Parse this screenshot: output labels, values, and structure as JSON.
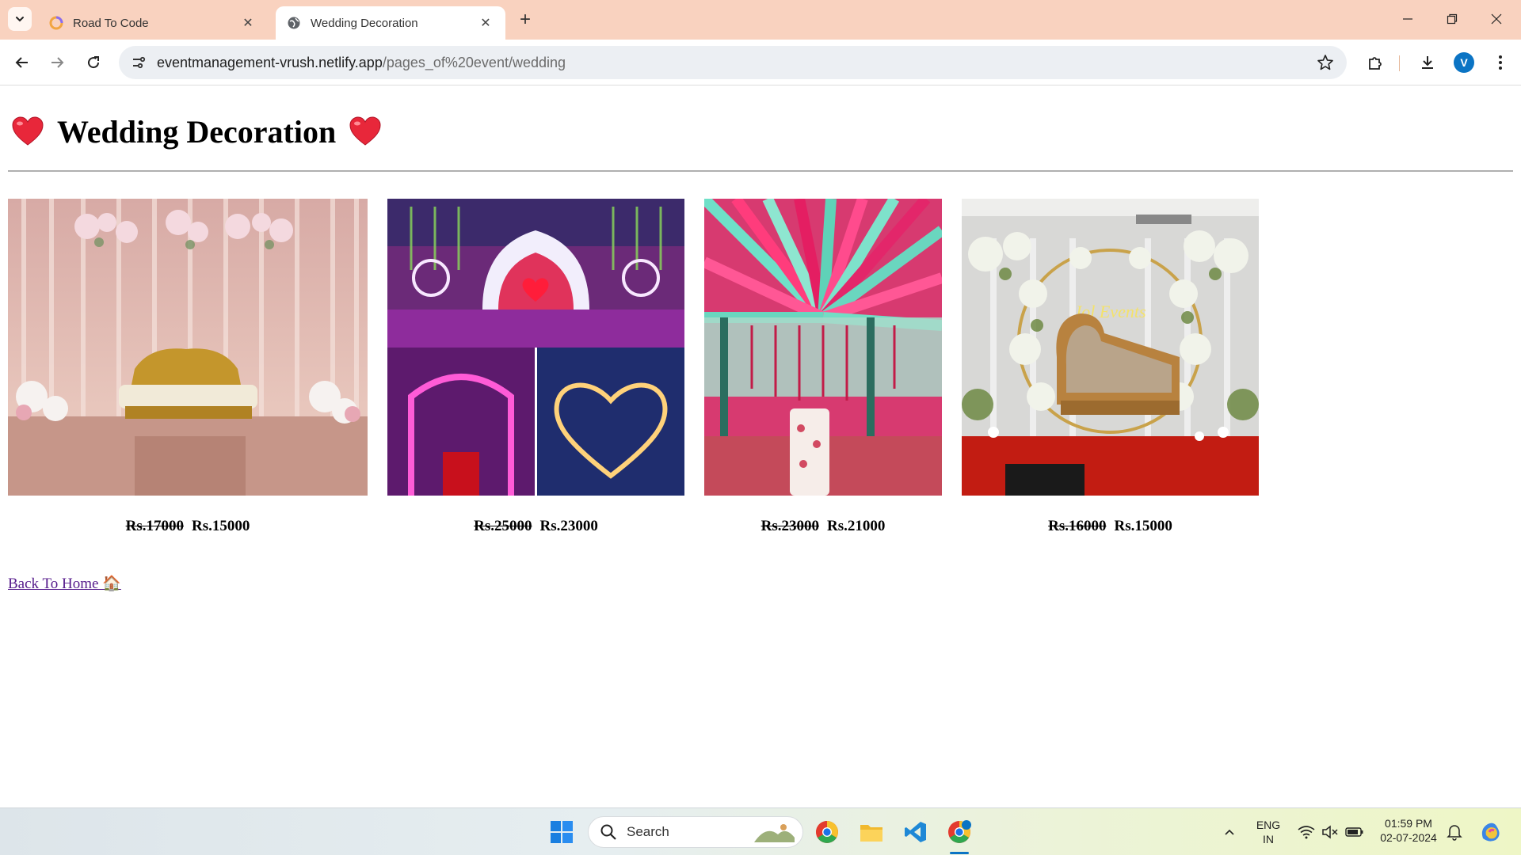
{
  "browser": {
    "tabs": [
      {
        "title": "Road To Code",
        "favicon": "road-to-code-icon",
        "active": false
      },
      {
        "title": "Wedding Decoration",
        "favicon": "globe-icon",
        "active": true
      }
    ],
    "url_domain": "eventmanagement-vrush.netlify.app",
    "url_path": "/pages_of%20event/wedding",
    "profile_initial": "V"
  },
  "page": {
    "heading": "Wedding Decoration",
    "products": [
      {
        "old_price": "Rs.17000",
        "new_price": "Rs.15000",
        "image": "gold-sofa-floral-stage"
      },
      {
        "old_price": "Rs.25000",
        "new_price": "Rs.23000",
        "image": "lit-stage-heart-collage"
      },
      {
        "old_price": "Rs.23000",
        "new_price": "Rs.21000",
        "image": "colorful-drape-canopy"
      },
      {
        "old_price": "Rs.16000",
        "new_price": "Rs.15000",
        "image": "floral-arch-chaise"
      }
    ],
    "back_link": "Back To Home 🏠"
  },
  "taskbar": {
    "search_label": "Search",
    "language": "ENG",
    "region": "IN",
    "time": "01:59 PM",
    "date": "02-07-2024"
  },
  "colors": {
    "tabstrip": "#f9d2bf",
    "link": "#551a8b",
    "accent": "#0b74c4"
  }
}
